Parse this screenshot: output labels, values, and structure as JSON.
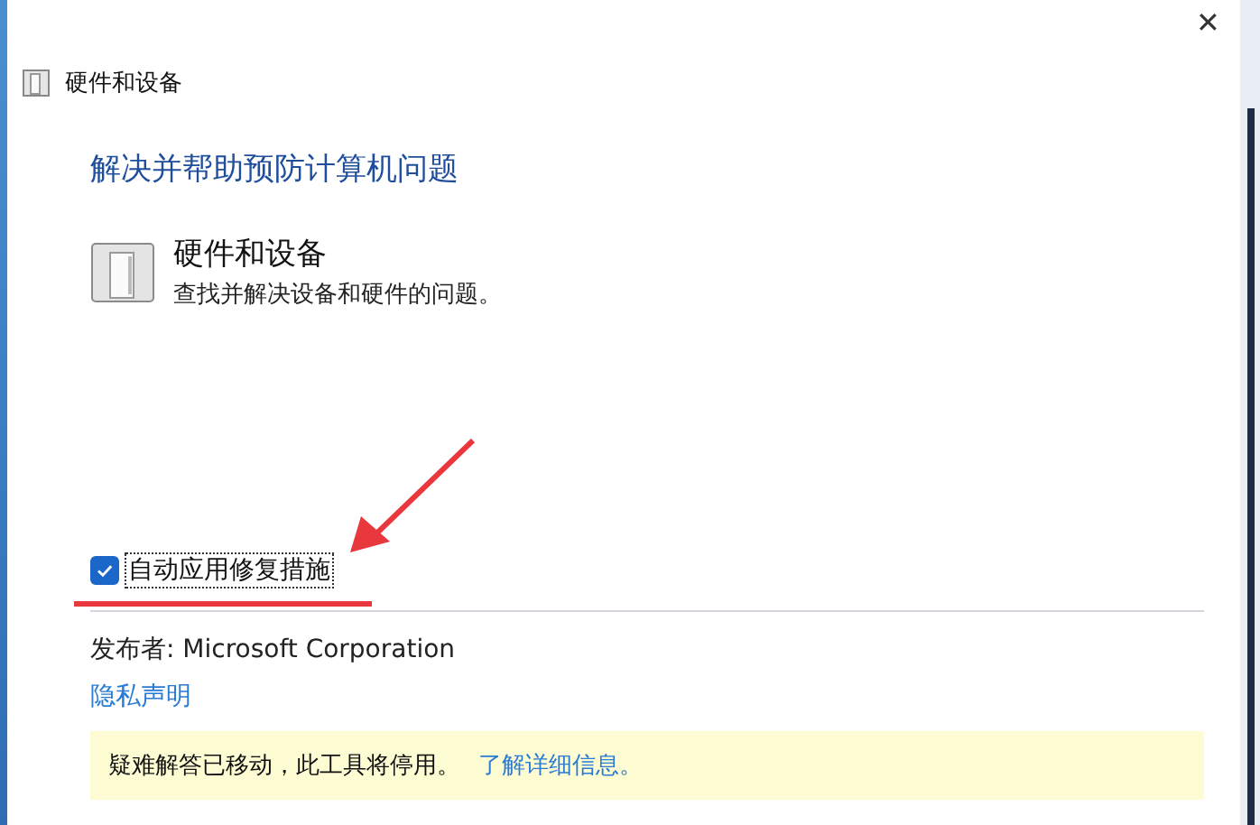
{
  "window": {
    "title": "硬件和设备",
    "close": "✕"
  },
  "heading": "解决并帮助预防计算机问题",
  "troubleshooter": {
    "title": "硬件和设备",
    "description": "查找并解决设备和硬件的问题。"
  },
  "auto_fix": {
    "label": "自动应用修复措施",
    "checked": true
  },
  "publisher": "发布者:  Microsoft Corporation",
  "privacy_link": "隐私声明",
  "notice": {
    "text": "疑难解答已移动，此工具将停用。",
    "link": "了解详细信息。"
  }
}
